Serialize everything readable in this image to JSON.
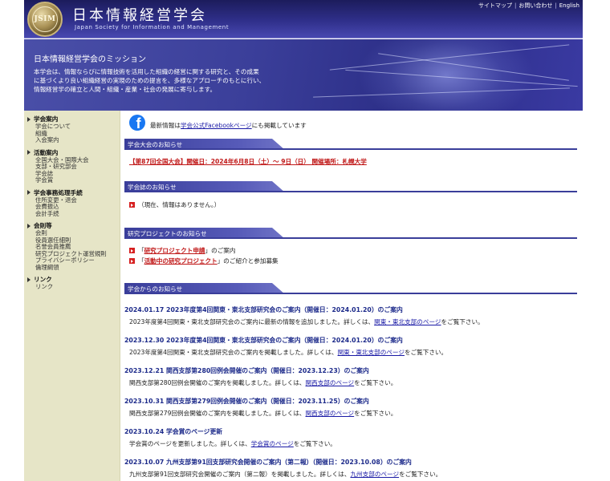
{
  "header": {
    "logo_text": "JSIM",
    "site_title": "日本情報経営学会",
    "site_subtitle": "Japan Society for Information and Management",
    "top_links": [
      "サイトマップ",
      "お問い合わせ",
      "English"
    ]
  },
  "mission": {
    "title": "日本情報経営学会のミッション",
    "lines": [
      "本学会は、情報ならびに情報技術を活用した組織の経営に関する研究と、その成果",
      "に基づくより良い組織経営の実現のための提言を、多様なアプローチのもとに行い、",
      "情報経営学の確立と人間・組織・産業・社会の発展に寄与します。"
    ]
  },
  "sidebar": {
    "sections": [
      {
        "title": "学会案内",
        "items": [
          "学会について",
          "組織",
          "入会案内"
        ]
      },
      {
        "title": "活動案内",
        "items": [
          "全国大会・国際大会",
          "支部・研究部会",
          "学会誌",
          "学会賞"
        ]
      },
      {
        "title": "学会事務処理手続",
        "items": [
          "住所変更・退会",
          "会費振込",
          "会計手続"
        ]
      },
      {
        "title": "会則等",
        "items": [
          "会則",
          "役員選任細則",
          "名誉会員推薦",
          "研究プロジェクト運営規則",
          "プライバシーポリシー",
          "倫理綱領"
        ]
      },
      {
        "title": "リンク",
        "items": [
          "リンク"
        ]
      }
    ]
  },
  "main": {
    "fb_prefix": "最新情報は",
    "fb_link": "学会公式Facebookページ",
    "fb_suffix": "にも掲載しています",
    "sections": {
      "conference": {
        "title": "学会大会のお知らせ",
        "link": "【第87回全国大会】開催日：2024年6月8日（土）～ 9日（日） 開催場所：札幌大学"
      },
      "journal": {
        "title": "学会誌のお知らせ",
        "text": "（現在、情報はありません。）"
      },
      "project": {
        "title": "研究プロジェクトのお知らせ",
        "items": [
          {
            "open": "「",
            "link": "研究プロジェクト申請",
            "rest": "」のご案内"
          },
          {
            "open": "「",
            "link": "活動中の研究プロジェクト",
            "rest": "」のご紹介と参加募集"
          }
        ]
      },
      "news": {
        "title": "学会からのお知らせ",
        "items": [
          {
            "title": "2024.01.17 2023年度第4回関東・東北支部研究会のご案内（開催日：2024.01.20）のご案内",
            "body": "2023年度第4回関東・東北支部研究会のご案内に最新の情報を追加しました。詳しくは、",
            "link": "関東・東北支部のページ",
            "tail": "をご覧下さい。"
          },
          {
            "title": "2023.12.30 2023年度第4回関東・東北支部研究会のご案内（開催日：2024.01.20）のご案内",
            "body": "2023年度第4回関東・東北支部研究会のご案内を掲載しました。詳しくは、",
            "link": "関東・東北支部のページ",
            "tail": "をご覧下さい。"
          },
          {
            "title": "2023.12.21 関西支部第280回例会開催のご案内（開催日：2023.12.23）のご案内",
            "body": "関西支部第280回例会開催のご案内を掲載しました。詳しくは、",
            "link": "関西支部のページ",
            "tail": "をご覧下さい。"
          },
          {
            "title": "2023.10.31 関西支部第279回例会開催のご案内（開催日：2023.11.25）のご案内",
            "body": "関西支部第279回例会開催のご案内を掲載しました。詳しくは、",
            "link": "関西支部のページ",
            "tail": "をご覧下さい。"
          },
          {
            "title": "2023.10.24 学会賞のページ更新",
            "body": "学会賞のページを更新しました。詳しくは、",
            "link": "学会賞のページ",
            "tail": "をご覧下さい。"
          },
          {
            "title": "2023.10.07 九州支部第91回支部研究会開催のご案内（第二報）（開催日：2023.10.08）のご案内",
            "body": "九州支部第91回支部研究会開催のご案内（第二報）を掲載しました。詳しくは、",
            "link": "九州支部のページ",
            "tail": "をご覧下さい。"
          }
        ]
      }
    }
  }
}
